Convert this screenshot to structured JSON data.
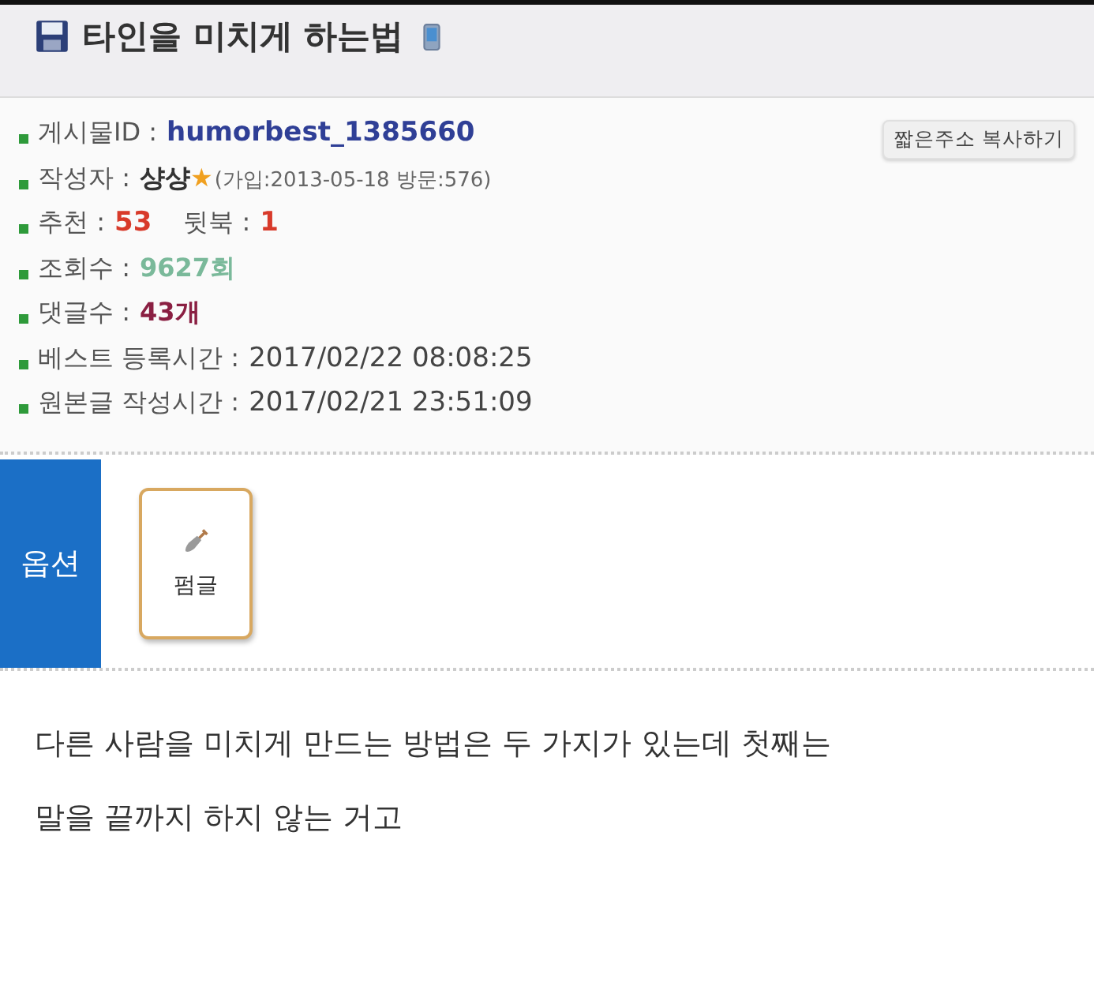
{
  "title": "타인을 미치게 하는법",
  "copy_button": "짧은주소 복사하기",
  "info_rows": [
    {
      "parts": [
        {
          "kind": "label",
          "text": "게시물ID :"
        },
        {
          "kind": "id",
          "text": "humorbest_1385660"
        }
      ]
    },
    {
      "parts": [
        {
          "kind": "label",
          "text": "작성자 :"
        },
        {
          "kind": "name",
          "text": "샹샹"
        },
        {
          "kind": "star",
          "text": "★"
        },
        {
          "kind": "note",
          "text": "(가입:2013-05-18 방문:576)"
        }
      ]
    },
    {
      "parts": [
        {
          "kind": "label",
          "text": "추천 :"
        },
        {
          "kind": "count",
          "text": "53"
        },
        {
          "kind": "label",
          "text": "뒷북 :"
        },
        {
          "kind": "count",
          "text": "1"
        }
      ]
    },
    {
      "parts": [
        {
          "kind": "label",
          "text": "조회수 :"
        },
        {
          "kind": "views",
          "text": "9627회"
        }
      ]
    },
    {
      "parts": [
        {
          "kind": "label",
          "text": "댓글수 :"
        },
        {
          "kind": "comments",
          "text": "43개"
        }
      ]
    },
    {
      "parts": [
        {
          "kind": "label",
          "text": "베스트 등록시간 :"
        },
        {
          "kind": "time",
          "text": "2017/02/22 08:08:25"
        }
      ]
    },
    {
      "parts": [
        {
          "kind": "label",
          "text": "원본글 작성시간 :"
        },
        {
          "kind": "time",
          "text": "2017/02/21 23:51:09"
        }
      ]
    }
  ],
  "options": {
    "label": "옵션",
    "buttons": [
      "펌글"
    ]
  },
  "body": [
    "다른 사람을 미치게 만드는 방법은 두 가지가 있는데 첫째는",
    "말을 끝까지 하지 않는 거고"
  ]
}
